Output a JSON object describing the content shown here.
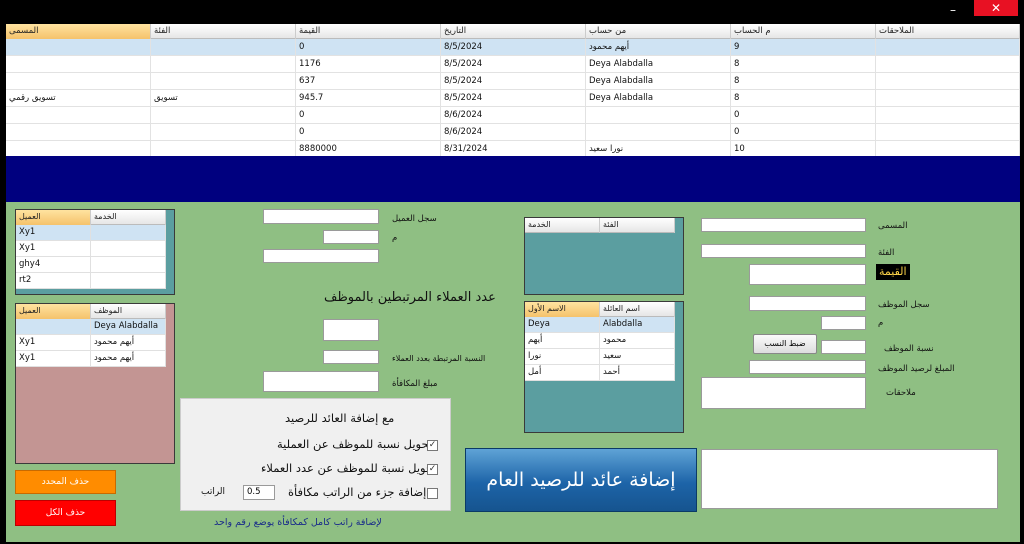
{
  "window": {
    "title": "",
    "minimize_glyph": "–",
    "close_glyph": "✕"
  },
  "top_grid": {
    "columns": [
      "المسمى",
      "الفئة",
      "القيمة",
      "التاريخ",
      "من حساب",
      "م الحساب",
      "الملاحقات"
    ],
    "rows": [
      [
        "",
        "",
        "0",
        "8/5/2024",
        "أيهم محمود",
        "9",
        ""
      ],
      [
        "",
        "",
        "1176",
        "8/5/2024",
        "Deya Alabdalla",
        "8",
        ""
      ],
      [
        "",
        "",
        "637",
        "8/5/2024",
        "Deya Alabdalla",
        "8",
        ""
      ],
      [
        "تسويق رقمي",
        "تسويق",
        "945.7",
        "8/5/2024",
        "Deya Alabdalla",
        "8",
        ""
      ],
      [
        "",
        "",
        "0",
        "8/6/2024",
        "",
        "0",
        ""
      ],
      [
        "",
        "",
        "0",
        "8/6/2024",
        "",
        "0",
        ""
      ],
      [
        "",
        "",
        "8880000",
        "8/31/2024",
        "نورا سعيد",
        "10",
        ""
      ]
    ]
  },
  "clients_grid": {
    "columns": [
      "العميل",
      "الخدمة"
    ],
    "rows": [
      [
        "Xy1",
        ""
      ],
      [
        "Xy1",
        ""
      ],
      [
        "ghy4",
        ""
      ],
      [
        "rt2",
        ""
      ]
    ]
  },
  "employees_grid": {
    "columns": [
      "العميل",
      "الموظف"
    ],
    "rows": [
      [
        "",
        "Deya Alabdalla"
      ],
      [
        "Xy1",
        "أيهم محمود"
      ],
      [
        "Xy1",
        "أيهم محمود"
      ]
    ]
  },
  "service_grid": {
    "columns": [
      "الخدمة",
      "الفئة"
    ]
  },
  "names_grid": {
    "columns": [
      "الاسم الأول",
      "اسم العائلة"
    ],
    "rows": [
      [
        "Deya",
        "Alabdalla"
      ],
      [
        "أيهم",
        "محمود"
      ],
      [
        "نورا",
        "سعيد"
      ],
      [
        "أمل",
        "أحمد"
      ]
    ]
  },
  "middle_form": {
    "client_record_label": "سجل العميل",
    "m_label": "م",
    "clients_count_title": "عدد العملاء المرتبطين بالموظف",
    "ratio_label": "النسبة المرتبطة بعدد العملاء",
    "bonus_label": "مبلغ المكافأة"
  },
  "options": {
    "title": "مع إضافة العائد للرصيد",
    "opt1": "تحويل نسبة للموظف عن العملية",
    "opt2": "تحويل نسبة للموظف عن عدد العملاء",
    "opt3": "إضافة جزء من الراتب مكافأة",
    "salary_label": "الراتب",
    "salary_value": "0.5",
    "checked_glyph": "✓"
  },
  "note": "لإضافة راتب كامل كمكافأة يوضع رقم واحد",
  "buttons": {
    "delete_selected": "حذف المحدد",
    "delete_all": "حذف الكل",
    "add_revenue": "إضافة عائد للرصيد العام",
    "set_ratios": "ضبط النسب"
  },
  "right_form": {
    "name_label": "المسمى",
    "category_label": "الفئة",
    "value_badge": "القيمة",
    "emp_record_label": "سجل الموظف",
    "m_label": "م",
    "emp_ratio_label": "نسبة الموظف",
    "emp_amount_label": "المبلغ لرصيد الموظف",
    "notes_label": "ملاحقات"
  },
  "colors": {
    "navy": "#00007f",
    "panel_green": "#8fbf83",
    "teal": "#5b9ea0",
    "rose": "#c39593",
    "orange": "#ff8c00",
    "red": "#ff0000"
  }
}
